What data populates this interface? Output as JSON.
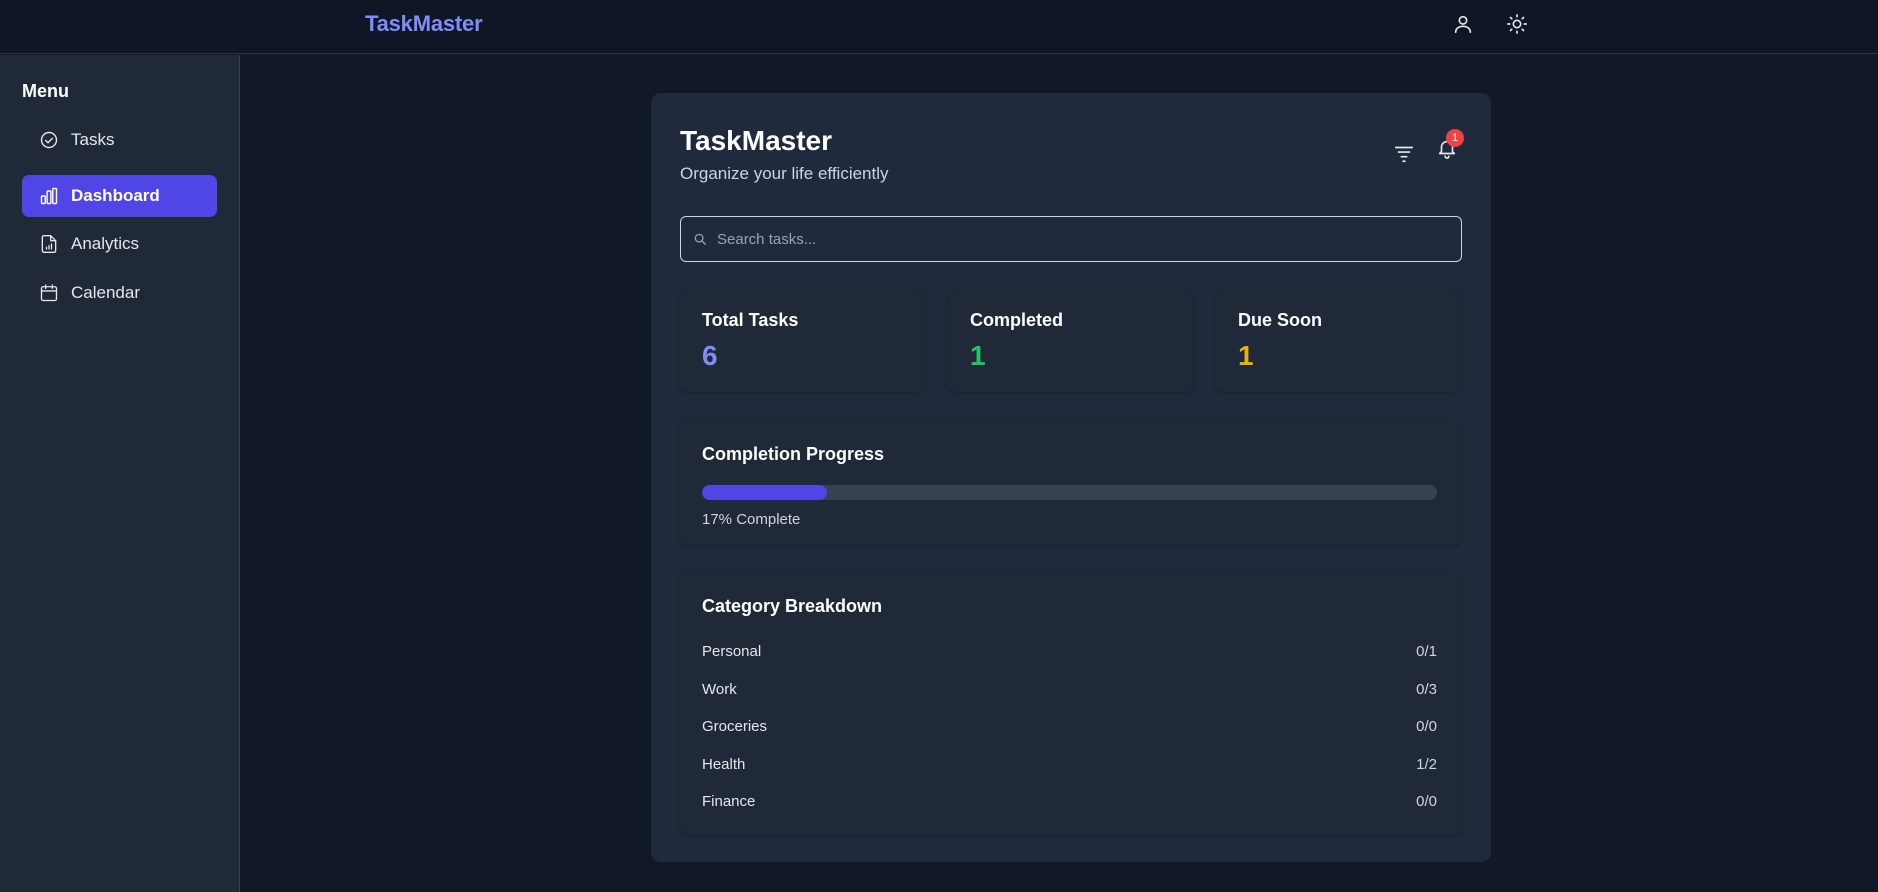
{
  "header": {
    "brand": "TaskMaster",
    "icons": [
      "user-icon",
      "sun-icon"
    ]
  },
  "sidebar": {
    "title": "Menu",
    "items": [
      {
        "label": "Tasks",
        "icon": "check-circle-icon",
        "active": false
      },
      {
        "label": "Dashboard",
        "icon": "bar-chart-icon",
        "active": true
      },
      {
        "label": "Analytics",
        "icon": "file-chart-icon",
        "active": false
      },
      {
        "label": "Calendar",
        "icon": "calendar-icon",
        "active": false
      }
    ]
  },
  "main": {
    "title": "TaskMaster",
    "subtitle": "Organize your life efficiently",
    "notification_count": "1",
    "search": {
      "placeholder": "Search tasks...",
      "value": ""
    },
    "stats": [
      {
        "label": "Total Tasks",
        "value": "6",
        "color": "#818cf8"
      },
      {
        "label": "Completed",
        "value": "1",
        "color": "#22c55e"
      },
      {
        "label": "Due Soon",
        "value": "1",
        "color": "#eab308"
      }
    ],
    "progress": {
      "title": "Completion Progress",
      "percent": 17,
      "label": "17% Complete"
    },
    "categories": {
      "title": "Category Breakdown",
      "items": [
        {
          "name": "Personal",
          "count": "0/1"
        },
        {
          "name": "Work",
          "count": "0/3"
        },
        {
          "name": "Groceries",
          "count": "0/0"
        },
        {
          "name": "Health",
          "count": "1/2"
        },
        {
          "name": "Finance",
          "count": "0/0"
        }
      ]
    }
  },
  "colors": {
    "accent": "#4f46e5",
    "brand": "#818cf8",
    "badge": "#ef4444"
  }
}
